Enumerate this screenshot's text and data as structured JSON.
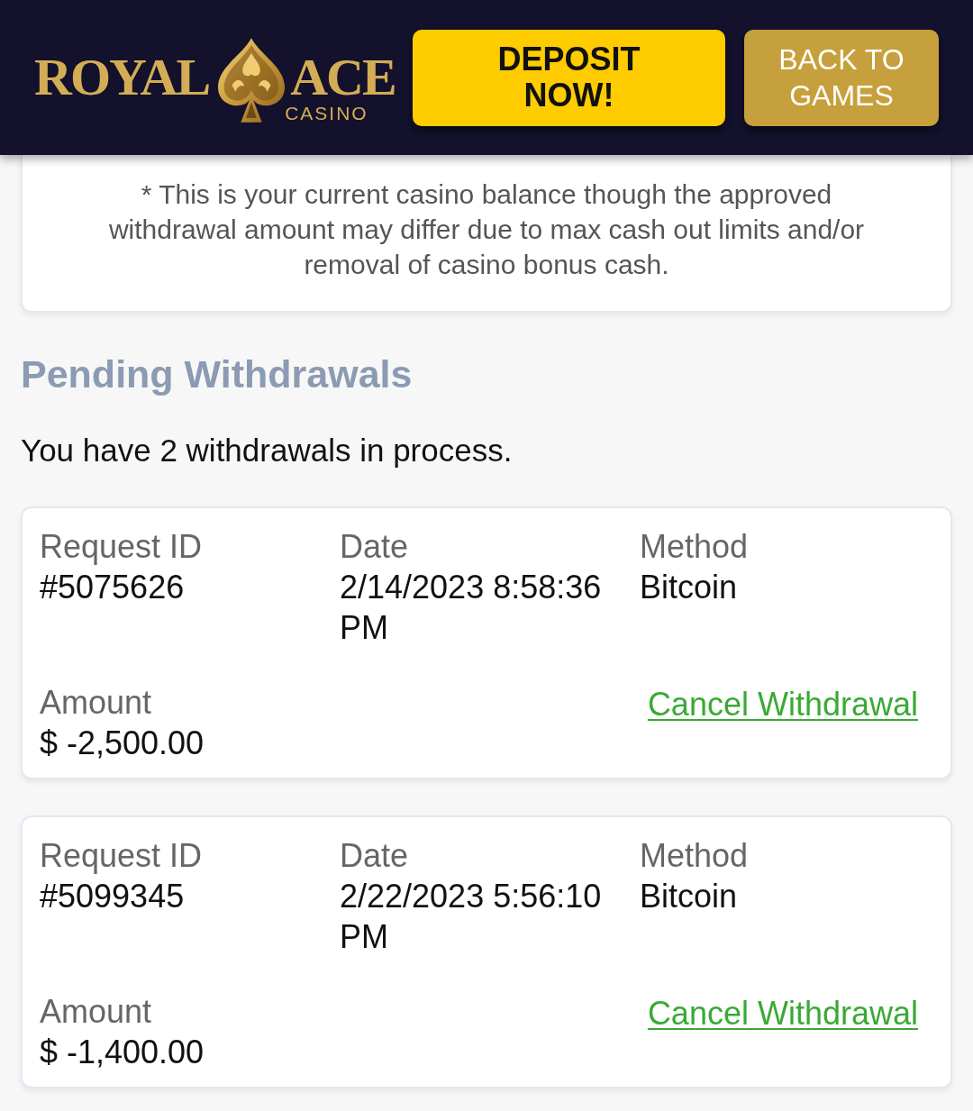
{
  "header": {
    "logo": {
      "word_1": "ROYAL",
      "word_2": "ACE",
      "tagline": "CASINO"
    },
    "buttons": [
      {
        "kind": "primary",
        "label": "DEPOSIT NOW!"
      },
      {
        "kind": "secondary",
        "label": "BACK TO GAMES"
      }
    ]
  },
  "balance_note": "* This is your current casino balance though the approved withdrawal amount may differ due to max cash out limits and/or removal of casino bonus cash.",
  "pending": {
    "title": "Pending Withdrawals",
    "summary": "You have 2 withdrawals in process.",
    "withdrawals": [
      {
        "request_id_label": "Request ID",
        "request_id": "#5075626",
        "date_label": "Date",
        "date": "2/14/2023 8:58:36 PM",
        "method_label": "Method",
        "method": "Bitcoin",
        "amount_label": "Amount",
        "amount": "$ -2,500.00",
        "cancel_link": "Cancel Withdrawal"
      },
      {
        "request_id_label": "Request ID",
        "request_id": "#5099345",
        "date_label": "Date",
        "date": "2/22/2023 5:56:10 PM",
        "method_label": "Method",
        "method": "Bitcoin",
        "amount_label": "Amount",
        "amount": "$ -1,400.00",
        "cancel_link": "Cancel Withdrawal"
      }
    ]
  }
}
